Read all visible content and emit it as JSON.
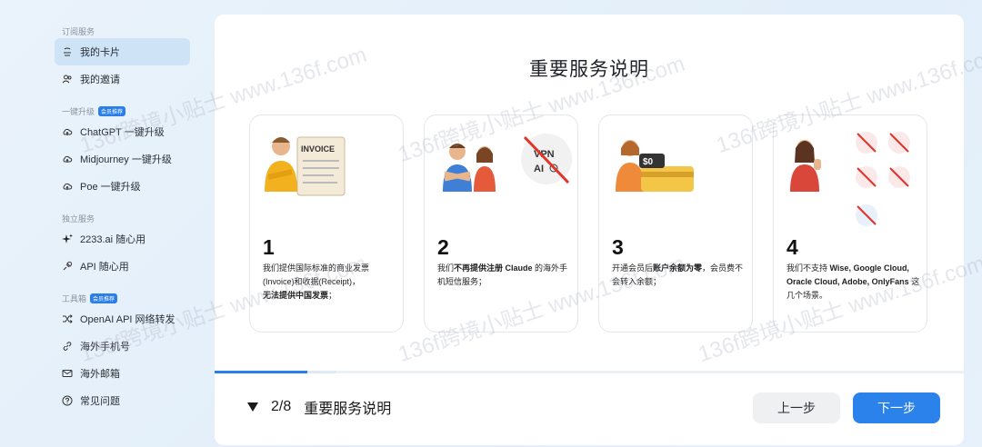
{
  "sidebar": {
    "section_subscribe": "订阅服务",
    "my_card": "我的卡片",
    "my_invite": "我的邀请",
    "section_upgrade": "一键升级",
    "upgrade_badge": "会员推荐",
    "chatgpt": "ChatGPT 一键升级",
    "midjourney": "Midjourney 一键升级",
    "poe": "Poe 一键升级",
    "section_standalone": "独立服务",
    "ai2233": "2233.ai 随心用",
    "api": "API 随心用",
    "section_tools": "工具箱",
    "tools_badge": "会员推荐",
    "openai_proxy": "OpenAI API 网络转发",
    "phone": "海外手机号",
    "mail": "海外邮箱",
    "faq": "常见问题"
  },
  "main": {
    "title": "重要服务说明",
    "cards": [
      {
        "number": "1",
        "line_a": "我们提供国际标准的商业发票",
        "line_b": "(Invoice)和收据(Receipt)，",
        "line_c": "无法提供中国发票",
        "line_c_tail": "；",
        "illus_label": "INVOICE"
      },
      {
        "number": "2",
        "pre": "我们",
        "bold": "不再提供注册 Claude",
        "post": " 的海外手机短信服务；",
        "illus_label_1": "VPN",
        "illus_label_2": "AI"
      },
      {
        "number": "3",
        "pre": "开通会员后",
        "bold": "账户余额为零",
        "post": "，会员费不会转入余额；",
        "illus_label": "$0"
      },
      {
        "number": "4",
        "pre": "我们不支持 ",
        "bold": "Wise, Google Cloud, Oracle Cloud, Adobe, OnlyFans",
        "post": " 这几个场景。"
      }
    ]
  },
  "footer": {
    "step": "2/8",
    "step_title": "重要服务说明",
    "prev": "上一步",
    "next": "下一步"
  },
  "watermark": "136f跨境小贴士 www.136f.com",
  "progress": {
    "current_step": 2,
    "total_steps": 8
  },
  "colors": {
    "accent": "#2b82ea",
    "sidebar_active": "#cfe3f7"
  }
}
